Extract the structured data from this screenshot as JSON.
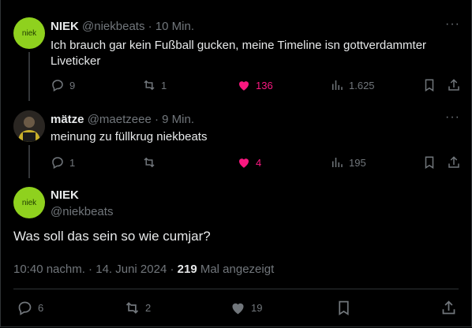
{
  "tweets": [
    {
      "name": "NIEK",
      "handle": "@niekbeats",
      "time": "10 Min.",
      "avatar_text": "niek",
      "text": "Ich brauch gar kein Fußball gucken, meine Timeline isn gottverdammter Liveticker",
      "replies": "9",
      "retweets": "1",
      "likes": "136",
      "views": "1.625"
    },
    {
      "name": "mätze",
      "handle": "@maetzeee",
      "time": "9 Min.",
      "text": "meinung zu füllkrug niekbeats",
      "replies": "1",
      "retweets": "",
      "likes": "4",
      "views": "195"
    }
  ],
  "main_tweet": {
    "name": "NIEK",
    "handle": "@niekbeats",
    "avatar_text": "niek",
    "text": "Was soll das sein so wie cumjar?",
    "timestamp": "10:40 nachm. · 14. Juni 2024 · ",
    "views_count": "219",
    "views_label": " Mal angezeigt",
    "replies": "6",
    "retweets": "2",
    "likes": "19"
  },
  "separator": "·",
  "colors": {
    "accent_like": "#f91880",
    "avatar_green": "#8fd11e",
    "muted": "#71767b"
  }
}
